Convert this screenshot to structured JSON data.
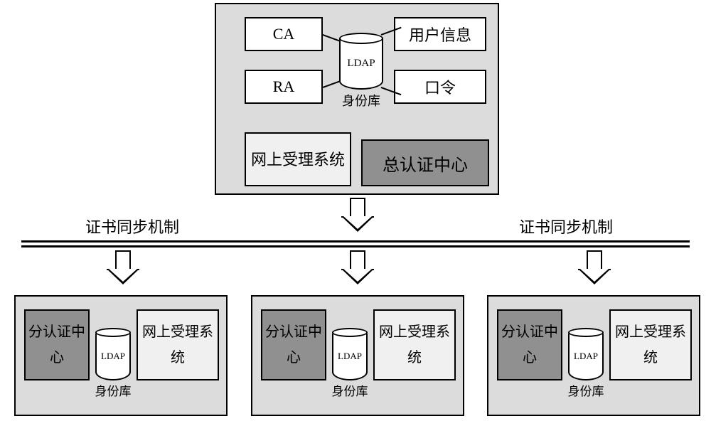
{
  "top": {
    "ca": "CA",
    "ra": "RA",
    "userinfo": "用户信息",
    "password": "口令",
    "ldap_label": "LDAP",
    "id_store": "身份库",
    "online_accept": "网上受理系统",
    "total_auth_center": "总认证中心"
  },
  "sync_label": "证书同步机制",
  "sub": {
    "sub_auth_center": "分认证中心",
    "ldap_label": "LDAP",
    "id_store": "身份库",
    "online_accept": "网上受理系统"
  },
  "chart_data": null
}
